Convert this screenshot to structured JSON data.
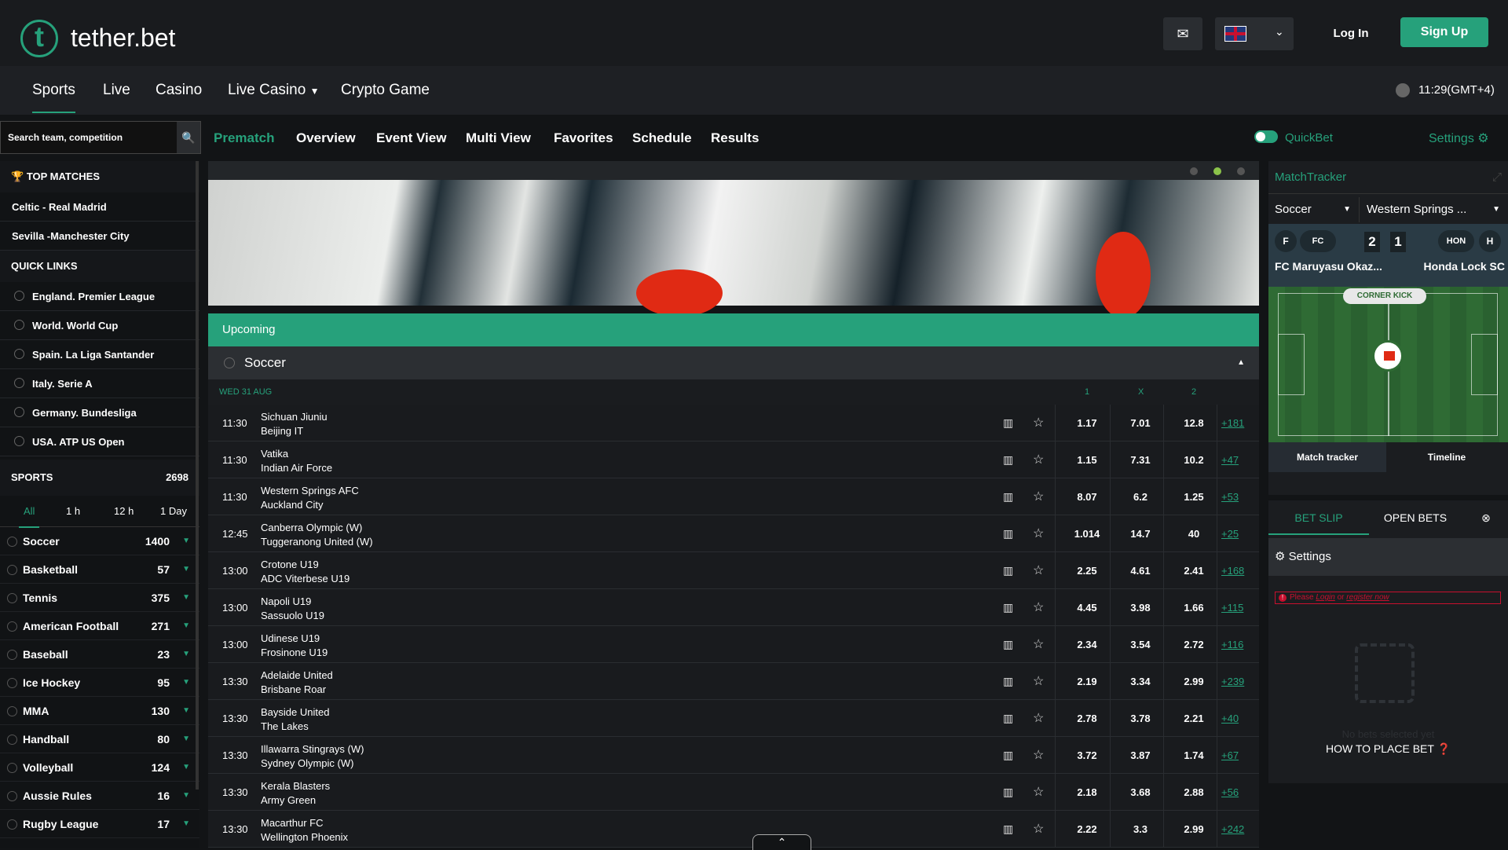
{
  "brand": {
    "name": "tether.bet",
    "logo_letter": "t"
  },
  "header": {
    "login": "Log In",
    "signup": "Sign Up",
    "mail_icon": "mail-icon",
    "language": "English (UK flag)"
  },
  "nav": {
    "items": [
      "Sports",
      "Live",
      "Casino",
      "Live Casino",
      "Crypto Game"
    ],
    "active": "Sports",
    "time": "11:29(GMT+4)"
  },
  "search": {
    "placeholder": "Search team, competition"
  },
  "subnav": {
    "items": [
      "Prematch",
      "Overview",
      "Event View",
      "Multi View",
      "Favorites",
      "Schedule",
      "Results"
    ],
    "active": "Prematch",
    "quickbet": "QuickBet",
    "settings": "Settings"
  },
  "left": {
    "top_matches_title": "TOP MATCHES",
    "top_matches": [
      "Celtic - Real Madrid",
      "Sevilla -Manchester City"
    ],
    "quick_links_title": "QUICK LINKS",
    "quick_links": [
      "England. Premier League",
      "World. World Cup",
      "Spain. La Liga Santander",
      "Italy. Serie A",
      "Germany. Bundesliga",
      "USA. ATP US Open"
    ],
    "sports_title": "SPORTS",
    "sports_total": "2698",
    "tabs": [
      "All",
      "1 h",
      "12 h",
      "1 Day"
    ],
    "sports": [
      {
        "name": "Soccer",
        "count": "1400"
      },
      {
        "name": "Basketball",
        "count": "57"
      },
      {
        "name": "Tennis",
        "count": "375"
      },
      {
        "name": "American Football",
        "count": "271"
      },
      {
        "name": "Baseball",
        "count": "23"
      },
      {
        "name": "Ice Hockey",
        "count": "95"
      },
      {
        "name": "MMA",
        "count": "130"
      },
      {
        "name": "Handball",
        "count": "80"
      },
      {
        "name": "Volleyball",
        "count": "124"
      },
      {
        "name": "Aussie Rules",
        "count": "16"
      },
      {
        "name": "Rugby League",
        "count": "17"
      }
    ]
  },
  "center": {
    "upcoming": "Upcoming",
    "sport": "Soccer",
    "date": "WED 31 AUG",
    "cols": [
      "1",
      "X",
      "2"
    ],
    "events": [
      {
        "time": "11:30",
        "home": "Sichuan Jiuniu",
        "away": "Beijing IT",
        "o1": "1.17",
        "ox": "7.01",
        "o2": "12.8",
        "more": "+181"
      },
      {
        "time": "11:30",
        "home": "Vatika",
        "away": "Indian Air Force",
        "o1": "1.15",
        "ox": "7.31",
        "o2": "10.2",
        "more": "+47"
      },
      {
        "time": "11:30",
        "home": "Western Springs AFC",
        "away": "Auckland City",
        "o1": "8.07",
        "ox": "6.2",
        "o2": "1.25",
        "more": "+53"
      },
      {
        "time": "12:45",
        "home": "Canberra Olympic (W)",
        "away": "Tuggeranong United (W)",
        "o1": "1.014",
        "ox": "14.7",
        "o2": "40",
        "more": "+25"
      },
      {
        "time": "13:00",
        "home": "Crotone U19",
        "away": "ADC Viterbese U19",
        "o1": "2.25",
        "ox": "4.61",
        "o2": "2.41",
        "more": "+168"
      },
      {
        "time": "13:00",
        "home": "Napoli U19",
        "away": "Sassuolo U19",
        "o1": "4.45",
        "ox": "3.98",
        "o2": "1.66",
        "more": "+115"
      },
      {
        "time": "13:00",
        "home": "Udinese U19",
        "away": "Frosinone U19",
        "o1": "2.34",
        "ox": "3.54",
        "o2": "2.72",
        "more": "+116"
      },
      {
        "time": "13:30",
        "home": "Adelaide United",
        "away": "Brisbane Roar",
        "o1": "2.19",
        "ox": "3.34",
        "o2": "2.99",
        "more": "+239"
      },
      {
        "time": "13:30",
        "home": "Bayside United",
        "away": "The Lakes",
        "o1": "2.78",
        "ox": "3.78",
        "o2": "2.21",
        "more": "+40"
      },
      {
        "time": "13:30",
        "home": "Illawarra Stingrays (W)",
        "away": "Sydney Olympic (W)",
        "o1": "3.72",
        "ox": "3.87",
        "o2": "1.74",
        "more": "+67"
      },
      {
        "time": "13:30",
        "home": "Kerala Blasters",
        "away": "Army Green",
        "o1": "2.18",
        "ox": "3.68",
        "o2": "2.88",
        "more": "+56"
      },
      {
        "time": "13:30",
        "home": "Macarthur FC",
        "away": "Wellington Phoenix",
        "o1": "2.22",
        "ox": "3.3",
        "o2": "2.99",
        "more": "+242"
      }
    ]
  },
  "tracker": {
    "title": "MatchTracker",
    "sport": "Soccer",
    "league": "Western Springs ...",
    "home_short": "F",
    "home_club": "FC",
    "away_short": "HON",
    "away_club": "H",
    "score_home": "2",
    "score_away": "1",
    "home_name": "FC Maruyasu Okaz...",
    "away_name": "Honda Lock SC",
    "event": "CORNER KICK",
    "btn_tracker": "Match tracker",
    "btn_timeline": "Timeline"
  },
  "betslip": {
    "tab_slip": "BET SLIP",
    "tab_open": "OPEN BETS",
    "settings": "Settings",
    "warn_prefix": "Please",
    "warn_login": "Login",
    "warn_or": "or",
    "warn_register": "register now",
    "no_bets": "No bets selected yet",
    "how_to": "HOW TO PLACE BET"
  },
  "colors": {
    "accent": "#26a17b",
    "background": "#121416",
    "panel": "#1b1d20",
    "alert": "#c8102e"
  }
}
